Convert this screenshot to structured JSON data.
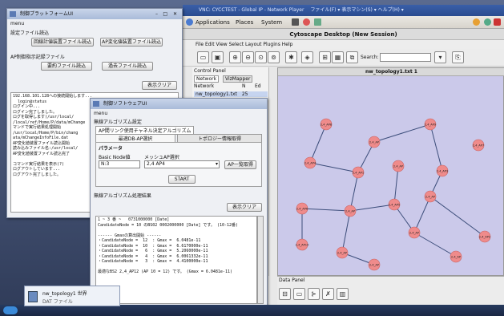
{
  "vnc": {
    "title": "VNC: CYCCTEST - Global IP - Network Player",
    "menu": "ファイル(F) ▾ 表示マシン(S) ▾ ヘルプ(H) ▾"
  },
  "gnome": {
    "applications": "Applications",
    "places": "Places",
    "system": "System"
  },
  "cytoscape": {
    "title": "Cytoscape Desktop (New Session)",
    "menu": "File  Edit  View  Select  Layout  Plugins  Help",
    "search_label": "Search:",
    "control_panel": "Control Panel",
    "tab_network": "Network",
    "tab_vizmapper": "VizMapper",
    "col_network": "Network",
    "col_n": "N",
    "col_ed": "Ed",
    "network_row": "nw_topology1.txt",
    "network_count": "25",
    "view_title": "nw_topology1.txt 1",
    "data_panel": "Data Panel"
  },
  "nodes": [
    {
      "id": "n1",
      "label": "2,4_AP8"
    },
    {
      "id": "n2",
      "label": "2,4_AP"
    },
    {
      "id": "n3",
      "label": "2,4_AP9"
    },
    {
      "id": "n4",
      "label": "2,4_AP7"
    },
    {
      "id": "n5",
      "label": "2,4_AP4"
    },
    {
      "id": "n6",
      "label": "2,4_AP1"
    },
    {
      "id": "n7",
      "label": "2,4_AP"
    },
    {
      "id": "n8",
      "label": "2,4_AP3"
    },
    {
      "id": "n9",
      "label": "2,4_AP6"
    },
    {
      "id": "n10",
      "label": "2,4_AP"
    },
    {
      "id": "n11",
      "label": "2,4_AP5"
    },
    {
      "id": "n12",
      "label": "2,4_AP"
    },
    {
      "id": "n13",
      "label": "2,4_AP2"
    },
    {
      "id": "n14",
      "label": "2,4_AP10"
    },
    {
      "id": "n15",
      "label": "2,4_AP"
    },
    {
      "id": "n16",
      "label": "2,4_AP"
    },
    {
      "id": "n17",
      "label": "2,4_AP"
    },
    {
      "id": "n18",
      "label": "2,4_AP"
    }
  ],
  "win1": {
    "title": "制御プラットフォームUI",
    "menu": "menu",
    "section1": "設定ファイル読込",
    "btn_topology": "回線計値装置ファイル読込",
    "btn_ap": "AP変化値装置ファイル読込",
    "section2": "AP制御指示記録ファイル",
    "btn_load": "要約ファイル読込",
    "btn_save": "過去ファイル読込",
    "btn_clear": "表示クリア",
    "log": "192.168.101.128への接続開始します...\n  login@status\nログイン中...\nログイン完了しました。\nログを取得します(/usr/local/\n/local/ref/Home/P/data/mChange\nマンドで実行結果処理開始\n/usr/local/Home/P/bin/chang\nata/mChangeInfoFile.dat\nAP変化値装置ファイル読込開始\n読み込みファイル名:/usr/local/\nAP変化値装置ファイル読込完了\n\nコマンド実行結果を表示(?)\nログアウトしています...\nログアウト完了しました。"
  },
  "win2": {
    "title": "制御ソフトウェアUI",
    "menu": "menu",
    "section1": "無線アルゴリズム設定",
    "tab1": "AP間リンク使用チャネル決定アルゴリズム",
    "tab2a": "最適DB-AP選択",
    "tab2b": "トポロジー情報取得",
    "param_heading": "パラメータ",
    "basic_node_label": "Basic Node値",
    "basic_node_value": "N:3",
    "mesh_label": "メッシュAP選択",
    "mesh_value": "2,4 AP4",
    "btn_list": "AP一覧取得",
    "btn_start": "START",
    "result_heading": "無線アルゴリズム処理結果",
    "btn_clear": "表示クリア",
    "result_log": "1 ~ 3 番 ~   0731000000 [Date]\nCandidateNode = 10 のBS02 0002000000 [Date] です。 (10-12番)\n\n------ Gmaxの算出開始 ------\n・CandidateNode =  12  : Gmax =  6.0481e-11\n・CandidateNode =  10  : Gmax =  6.6170000e-11\n・CandidateNode =   6  : Gmax =  5.2060000e-11\n・CandidateNode =   4  : Gmax =  6.0061332e-11\n・CandidateNode =   3  : Gmax =  4.4100000e-11\n\n最適なBS2 2,4_AP12 (AP 10 = 12) です。 (Gmax = 6.0481e-11)"
  },
  "taskbar": {
    "item1": "nw_topology1 世界",
    "item2": "DAT ファイル"
  }
}
